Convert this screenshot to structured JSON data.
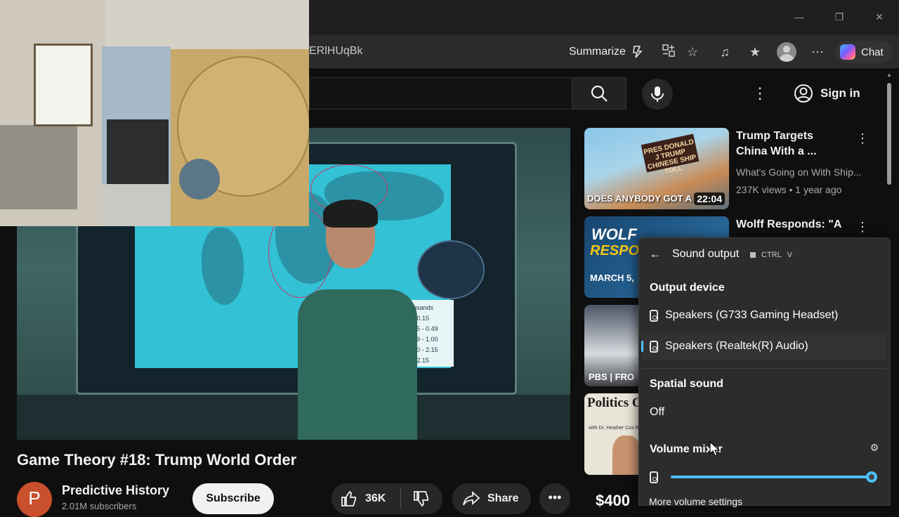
{
  "browser": {
    "url_fragment": "ERlHUqBk",
    "summarize_label": "Summarize",
    "chat_label": "Chat",
    "window_controls": [
      "minimize-icon",
      "restore-icon",
      "close-icon"
    ],
    "toolbar_icons": [
      "copilot-summary-icon",
      "split-screen-icon",
      "favorite-star-icon",
      "media-control-icon",
      "favorites-icon",
      "profile-avatar",
      "more-icon",
      "copilot-icon"
    ]
  },
  "youtube": {
    "sign_in_label": "Sign in",
    "video": {
      "title": "Game Theory #18: Trump World Order",
      "legend_title": "usands",
      "legend_rows": [
        "- 0.15",
        "15 - 0.49",
        "49 - 1.00",
        "00 - 2.15",
        "- 2.15"
      ],
      "dial_label": ""
    },
    "channel": {
      "avatar_letter": "P",
      "name": "Predictive History",
      "subscribers": "2.01M subscribers",
      "subscribe_label": "Subscribe"
    },
    "actions": {
      "likes": "36K",
      "share_label": "Share",
      "more_label": "•••"
    },
    "recommendations": [
      {
        "title_line1": "Trump Targets",
        "title_line2": "China With a ...",
        "channel": "What's Going on With Ship...",
        "meta": "237K views • 1 year ago",
        "duration": "22:04",
        "thumb_caption": "DOES ANYBODY GOT A",
        "thumb_banner": "PRES DONALD J TRUMP CHINESE SHIP TOLL"
      },
      {
        "title_line1": "Wolff Responds: \"A",
        "thumb_line1": "WOLF",
        "thumb_line2": "RESPO",
        "thumb_date": "MARCH 5,"
      },
      {
        "thumb_logo": "PBS | FRO"
      },
      {
        "thumb_title": "Politics Chat",
        "thumb_sub": "with Dr. Heather Cox Richardson"
      },
      {
        "thumb_price": "$400"
      }
    ]
  },
  "sound_flyout": {
    "title": "Sound output",
    "shortcut_keys": [
      "CTRL",
      "V"
    ],
    "output_device_heading": "Output device",
    "devices": [
      {
        "label": "Speakers (G733 Gaming Headset)",
        "selected": false
      },
      {
        "label": "Speakers (Realtek(R) Audio)",
        "selected": true
      }
    ],
    "spatial_heading": "Spatial sound",
    "spatial_value": "Off",
    "volume_mixer_heading": "Volume mixer",
    "volume_level_percent": 100,
    "more_settings_label": "More volume settings",
    "accent_color": "#4cc2ff"
  },
  "colors": {
    "page_bg": "#0f0f0f",
    "channel_avatar": "#c94f2d"
  }
}
